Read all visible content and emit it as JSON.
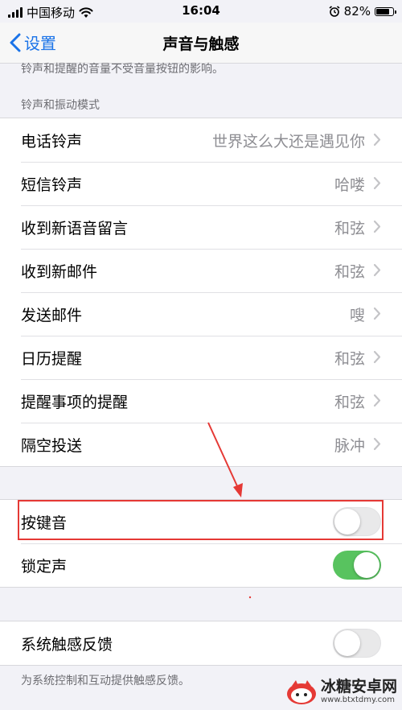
{
  "status_bar": {
    "carrier": "中国移动",
    "time": "16:04",
    "battery_percent": "82%",
    "battery_level": 0.82
  },
  "nav": {
    "back_label": "设置",
    "title": "声音与触感"
  },
  "top_note": "铃声和提醒的音量不受音量按钮的影响。",
  "ringtone_section": {
    "header": "铃声和振动模式",
    "rows": [
      {
        "label": "电话铃声",
        "value": "世界这么大还是遇见你"
      },
      {
        "label": "短信铃声",
        "value": "哈喽"
      },
      {
        "label": "收到新语音留言",
        "value": "和弦"
      },
      {
        "label": "收到新邮件",
        "value": "和弦"
      },
      {
        "label": "发送邮件",
        "value": "嗖"
      },
      {
        "label": "日历提醒",
        "value": "和弦"
      },
      {
        "label": "提醒事项的提醒",
        "value": "和弦"
      },
      {
        "label": "隔空投送",
        "value": "脉冲"
      }
    ]
  },
  "sound_section": {
    "keyboard_clicks": {
      "label": "按键音",
      "on": false
    },
    "lock_sound": {
      "label": "锁定声",
      "on": true
    }
  },
  "haptics_section": {
    "system_haptics": {
      "label": "系统触感反馈",
      "on": false
    },
    "footer": "为系统控制和互动提供触感反馈。"
  },
  "watermark": {
    "name": "冰糖安卓网",
    "url": "www.btxtdmy.com"
  },
  "colors": {
    "accent": "#1a73e8",
    "toggle_on": "#58c35f",
    "annotation_red": "#e53935"
  }
}
